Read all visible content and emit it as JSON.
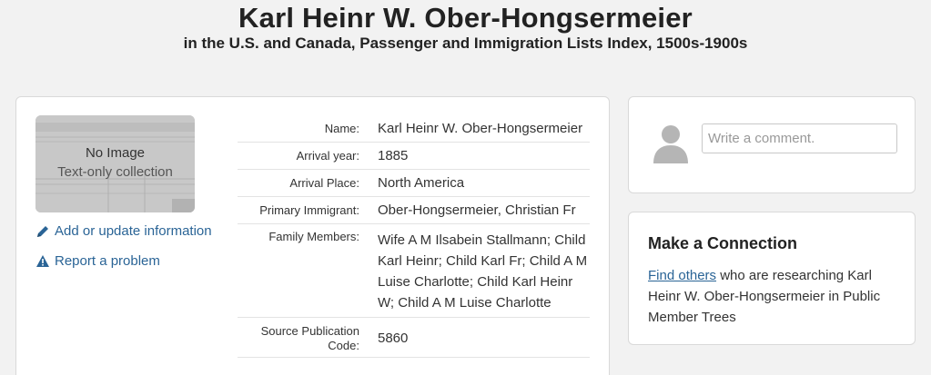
{
  "header": {
    "title": "Karl Heinr W. Ober-Hongsermeier",
    "subtitle": "in the U.S. and Canada, Passenger and Immigration Lists Index, 1500s-1900s"
  },
  "image": {
    "no_image": "No Image",
    "collection_type": "Text-only collection"
  },
  "actions": {
    "add_update": "Add or update information",
    "report": "Report a problem"
  },
  "record": {
    "name_label": "Name:",
    "name_value": "Karl Heinr W. Ober-Hongsermeier",
    "arrival_year_label": "Arrival year:",
    "arrival_year_value": "1885",
    "arrival_place_label": "Arrival Place:",
    "arrival_place_value": "North America",
    "primary_immigrant_label": "Primary Immigrant:",
    "primary_immigrant_value": "Ober-Hongsermeier, Christian Fr",
    "family_members_label": "Family Members:",
    "family_members_value": "Wife A M Ilsabein Stallmann; Child Karl Heinr; Child Karl Fr; Child A M Luise Charlotte; Child Karl Heinr W; Child A M Luise Charlotte",
    "source_label": "Source Publication Code:",
    "source_value": "5860"
  },
  "comment": {
    "placeholder": "Write a comment."
  },
  "connection": {
    "title": "Make a Connection",
    "link_text": "Find others",
    "body_text": " who are researching Karl Heinr W. Ober-Hongsermeier in Public Member Trees"
  },
  "colors": {
    "link": "#2a6496",
    "background": "#f2f2f2"
  },
  "icons": [
    "pencil-icon",
    "warning-icon",
    "avatar-icon"
  ]
}
